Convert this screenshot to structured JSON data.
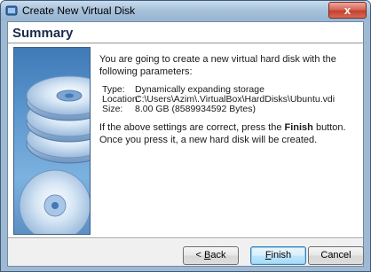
{
  "window": {
    "title": "Create New Virtual Disk",
    "close_symbol": "x",
    "accent_color": "#9fb9d3"
  },
  "header": {
    "title": "Summary"
  },
  "summary": {
    "intro": "You are going to create a new virtual hard disk with the following parameters:",
    "params": [
      {
        "label": "Type:",
        "value": "Dynamically expanding storage"
      },
      {
        "label": "Location:",
        "value": "C:\\Users\\Azim\\.VirtualBox\\HardDisks\\Ubuntu.vdi"
      },
      {
        "label": "Size:",
        "value": "8.00 GB (8589934592 Bytes)"
      }
    ],
    "note_before": "If the above settings are correct, press the ",
    "note_bold": "Finish",
    "note_after": " button. Once you press it, a new hard disk will be created."
  },
  "buttons": {
    "back_prefix": "< ",
    "back_mnemonic": "B",
    "back_rest": "ack",
    "finish_mnemonic": "F",
    "finish_rest": "inish",
    "cancel_label": "Cancel"
  }
}
